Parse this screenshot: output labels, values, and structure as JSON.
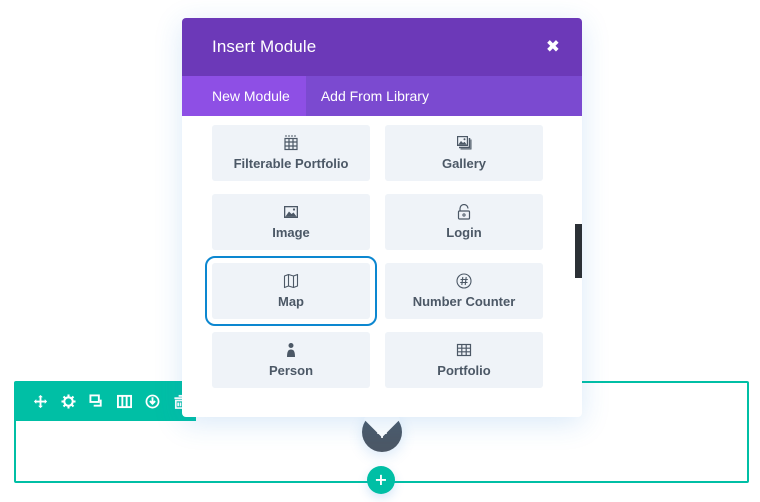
{
  "modal": {
    "title": "Insert Module",
    "close_icon": "close-icon",
    "tabs": [
      {
        "label": "New Module",
        "active": true
      },
      {
        "label": "Add From Library",
        "active": false
      }
    ],
    "modules": [
      {
        "label": "Filterable Portfolio",
        "icon": "grid-icon"
      },
      {
        "label": "Gallery",
        "icon": "gallery-icon"
      },
      {
        "label": "Image",
        "icon": "image-icon"
      },
      {
        "label": "Login",
        "icon": "lock-open-icon"
      },
      {
        "label": "Map",
        "icon": "map-icon",
        "selected": true
      },
      {
        "label": "Number Counter",
        "icon": "hash-icon"
      },
      {
        "label": "Person",
        "icon": "person-icon"
      },
      {
        "label": "Portfolio",
        "icon": "grid-icon"
      }
    ]
  },
  "row_toolbar": {
    "icons": [
      "move-icon",
      "gear-icon",
      "duplicate-icon",
      "columns-icon",
      "save-icon",
      "trash-icon"
    ]
  },
  "add_module_button": {
    "label": "+"
  },
  "add_row_button": {
    "label": "+"
  },
  "colors": {
    "header": "#6c39b8",
    "tab_active": "#8e4fe5",
    "tab_bar": "#7b4ad0",
    "row_accent": "#00bfa5",
    "selected_outline": "#0c87d0",
    "module_bg": "#eff3f8",
    "module_text": "#4c5866"
  }
}
